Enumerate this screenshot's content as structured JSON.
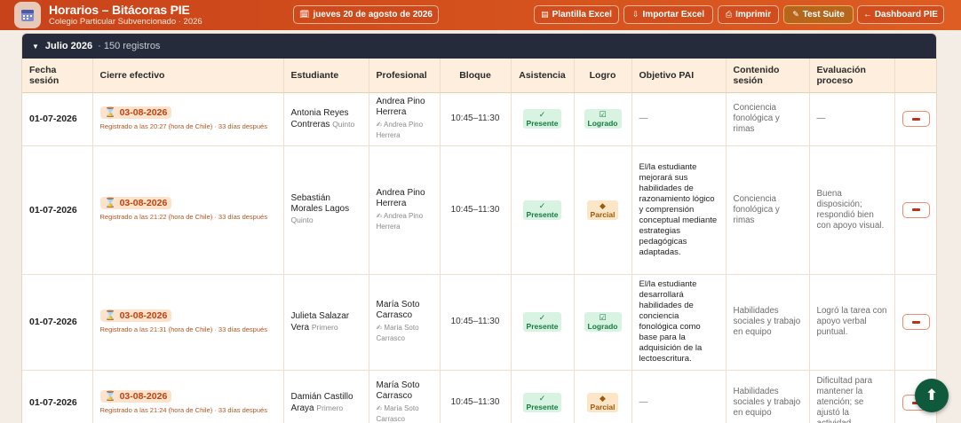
{
  "header": {
    "title": "Horarios – Bitácoras PIE",
    "subtitle": "Colegio Particular Subvencionado · 2026",
    "date_label": "jueves 20 de agosto de 2026",
    "buttons": {
      "plantilla": "Plantilla Excel",
      "importar": "Importar Excel",
      "imprimir": "Imprimir",
      "test": "Test Suite",
      "dashboard": "← Dashboard PIE"
    }
  },
  "month": {
    "name": "Julio 2026",
    "count": "· 150 registros"
  },
  "columns": [
    "Fecha sesión",
    "Cierre efectivo",
    "Estudiante",
    "Profesional",
    "Bloque",
    "Asistencia",
    "Logro",
    "Objetivo PAI",
    "Contenido sesión",
    "Evaluación proceso",
    ""
  ],
  "rows": [
    {
      "fecha": "01-07-2026",
      "cierre_date": "03-08-2026",
      "cierre_note": "Registrado a las 20:27 (hora de Chile) · 33 días después",
      "student": "Antonia Reyes Contreras",
      "grade": "Quinto",
      "prof": "Andrea Pino Herrera",
      "prof_sub": "✍ Andrea Pino Herrera",
      "bloque": "10:45–11:30",
      "asistencia": "Presente",
      "logro": "Logrado",
      "objetivo": "—",
      "contenido": "Conciencia fonológica y rimas",
      "evaluacion": "—"
    },
    {
      "fecha": "01-07-2026",
      "cierre_date": "03-08-2026",
      "cierre_note": "Registrado a las 21:22 (hora de Chile) · 33 días después",
      "student": "Sebastián Morales Lagos",
      "grade": "Quinto",
      "prof": "Andrea Pino Herrera",
      "prof_sub": "✍ Andrea Pino Herrera",
      "bloque": "10:45–11:30",
      "asistencia": "Presente",
      "logro": "Parcial",
      "objetivo": "El/la estudiante mejorará sus habilidades de razonamiento lógico y comprensión conceptual mediante estrategias pedagógicas adaptadas.",
      "contenido": "Conciencia fonológica y rimas",
      "evaluacion": "Buena disposición; respondió bien con apoyo visual."
    },
    {
      "fecha": "01-07-2026",
      "cierre_date": "03-08-2026",
      "cierre_note": "Registrado a las 21:31 (hora de Chile) · 33 días después",
      "student": "Julieta Salazar Vera",
      "grade": "Primero",
      "prof": "María Soto Carrasco",
      "prof_sub": "✍ María Soto Carrasco",
      "bloque": "10:45–11:30",
      "asistencia": "Presente",
      "logro": "Logrado",
      "objetivo": "El/la estudiante desarrollará habilidades de conciencia fonológica como base para la adquisición de la lectoescritura.",
      "contenido": "Habilidades sociales y trabajo en equipo",
      "evaluacion": "Logró la tarea con apoyo verbal puntual."
    },
    {
      "fecha": "01-07-2026",
      "cierre_date": "03-08-2026",
      "cierre_note": "Registrado a las 21:24 (hora de Chile) · 33 días después",
      "student": "Damián Castillo Araya",
      "grade": "Primero",
      "prof": "María Soto Carrasco",
      "prof_sub": "✍ María Soto Carrasco",
      "bloque": "10:45–11:30",
      "asistencia": "Presente",
      "logro": "Parcial",
      "objetivo": "—",
      "contenido": "Habilidades sociales y trabajo en equipo",
      "evaluacion": "Dificultad para mantener la atención; se ajustó la actividad."
    }
  ],
  "colors": {
    "brand": "#d24d1d",
    "header_dark": "#262b3b",
    "fab": "#0f5a3d"
  }
}
